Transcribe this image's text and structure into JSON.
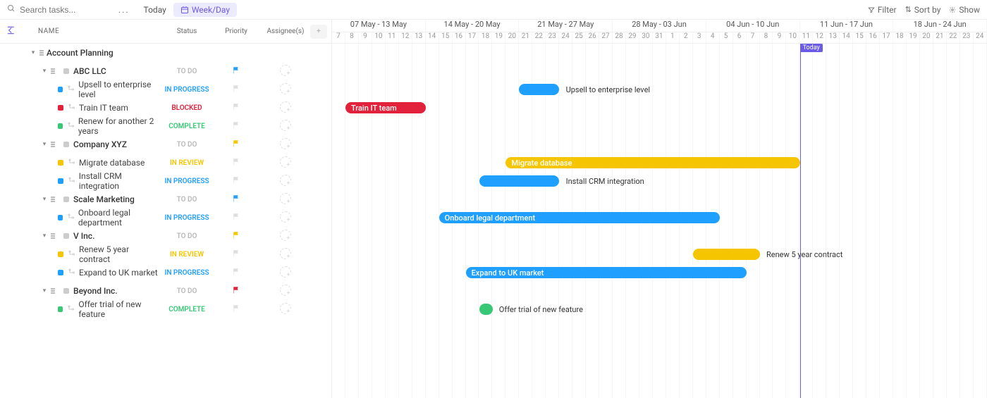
{
  "toolbar": {
    "search_placeholder": "Search tasks...",
    "dots": "...",
    "today": "Today",
    "weekday": "Week/Day",
    "filter": "Filter",
    "sortby": "Sort by",
    "show": "Show"
  },
  "columns": {
    "name": "NAME",
    "status": "Status",
    "priority": "Priority",
    "assignees": "Assignee(s)",
    "add": "+"
  },
  "tree": [
    {
      "type": "folder",
      "level": 0,
      "name": "Account Planning"
    },
    {
      "type": "group",
      "level": 1,
      "name": "ABC LLC",
      "color": "#1f9fff",
      "status": "TO DO",
      "status_class": "st-todo",
      "flag": "#1f9fff"
    },
    {
      "type": "task",
      "level": 2,
      "name": "Upsell to enterprise level",
      "color": "#1f9fff",
      "status": "IN PROGRESS",
      "status_class": "st-inprogress",
      "flag": ""
    },
    {
      "type": "task",
      "level": 2,
      "name": "Train IT team",
      "color": "#e2223a",
      "status": "BLOCKED",
      "status_class": "st-blocked",
      "flag": ""
    },
    {
      "type": "task",
      "level": 2,
      "name": "Renew for another 2 years",
      "color": "#37c775",
      "status": "COMPLETE",
      "status_class": "st-complete",
      "flag": ""
    },
    {
      "type": "group",
      "level": 1,
      "name": "Company XYZ",
      "color": "#999",
      "status": "TO DO",
      "status_class": "st-todo",
      "flag": "#f5c500"
    },
    {
      "type": "task",
      "level": 2,
      "name": "Migrate database",
      "color": "#f5c500",
      "status": "IN REVIEW",
      "status_class": "st-inreview",
      "flag": ""
    },
    {
      "type": "task",
      "level": 2,
      "name": "Install CRM integration",
      "color": "#1f9fff",
      "status": "IN PROGRESS",
      "status_class": "st-inprogress",
      "flag": ""
    },
    {
      "type": "group",
      "level": 1,
      "name": "Scale Marketing",
      "color": "#999",
      "status": "TO DO",
      "status_class": "st-todo",
      "flag": "#1f9fff"
    },
    {
      "type": "task",
      "level": 2,
      "name": "Onboard legal department",
      "color": "#1f9fff",
      "status": "IN PROGRESS",
      "status_class": "st-inprogress",
      "flag": ""
    },
    {
      "type": "group",
      "level": 1,
      "name": "V Inc.",
      "color": "#999",
      "status": "TO DO",
      "status_class": "st-todo",
      "flag": "#f5c500"
    },
    {
      "type": "task",
      "level": 2,
      "name": "Renew 5 year contract",
      "color": "#f5c500",
      "status": "IN REVIEW",
      "status_class": "st-inreview",
      "flag": ""
    },
    {
      "type": "task",
      "level": 2,
      "name": "Expand to UK market",
      "color": "#1f9fff",
      "status": "IN PROGRESS",
      "status_class": "st-inprogress",
      "flag": ""
    },
    {
      "type": "group",
      "level": 1,
      "name": "Beyond Inc.",
      "color": "#999",
      "status": "TO DO",
      "status_class": "st-todo",
      "flag": "#e2223a"
    },
    {
      "type": "task",
      "level": 2,
      "name": "Offer trial of new feature",
      "color": "#37c775",
      "status": "COMPLETE",
      "status_class": "st-complete",
      "flag": ""
    }
  ],
  "weeks": [
    "07 May - 13 May",
    "14 May - 20 May",
    "21 May - 27 May",
    "28 May - 03 Jun",
    "04 Jun - 10 Jun",
    "11 Jun - 17 Jun",
    "18 Jun - 24 Jun"
  ],
  "days": [
    "7",
    "8",
    "9",
    "10",
    "11",
    "12",
    "13",
    "14",
    "15",
    "16",
    "17",
    "18",
    "19",
    "20",
    "21",
    "22",
    "23",
    "24",
    "25",
    "26",
    "27",
    "28",
    "29",
    "30",
    "31",
    "1",
    "2",
    "3",
    "4",
    "5",
    "6",
    "7",
    "8",
    "9",
    "10",
    "11",
    "12",
    "13",
    "14",
    "15",
    "16",
    "17",
    "18",
    "19",
    "20",
    "21",
    "22",
    "23",
    "24"
  ],
  "today": {
    "label": "Today",
    "dayIndex": 35
  },
  "bars": [
    {
      "row": 2,
      "startDay": 14,
      "span": 3,
      "color": "c-blue",
      "label": "Upsell to enterprise level",
      "labelInside": false
    },
    {
      "row": 3,
      "startDay": 1,
      "span": 6,
      "color": "c-red",
      "label": "Train IT team",
      "labelInside": true
    },
    {
      "row": 6,
      "startDay": 13,
      "span": 22,
      "color": "c-yellow",
      "label": "Migrate database",
      "labelInside": true
    },
    {
      "row": 7,
      "startDay": 11,
      "span": 6,
      "color": "c-blue",
      "label": "Install CRM integration",
      "labelInside": false
    },
    {
      "row": 9,
      "startDay": 8,
      "span": 21,
      "color": "c-blue",
      "label": "Onboard legal department",
      "labelInside": true
    },
    {
      "row": 11,
      "startDay": 27,
      "span": 5,
      "color": "c-yellow",
      "label": "Renew 5 year contract",
      "labelInside": false
    },
    {
      "row": 12,
      "startDay": 10,
      "span": 21,
      "color": "c-blue",
      "label": "Expand to UK market",
      "labelInside": true
    },
    {
      "row": 14,
      "startDay": 11,
      "span": 1,
      "color": "c-green",
      "label": "Offer trial of new feature",
      "labelInside": false
    }
  ]
}
